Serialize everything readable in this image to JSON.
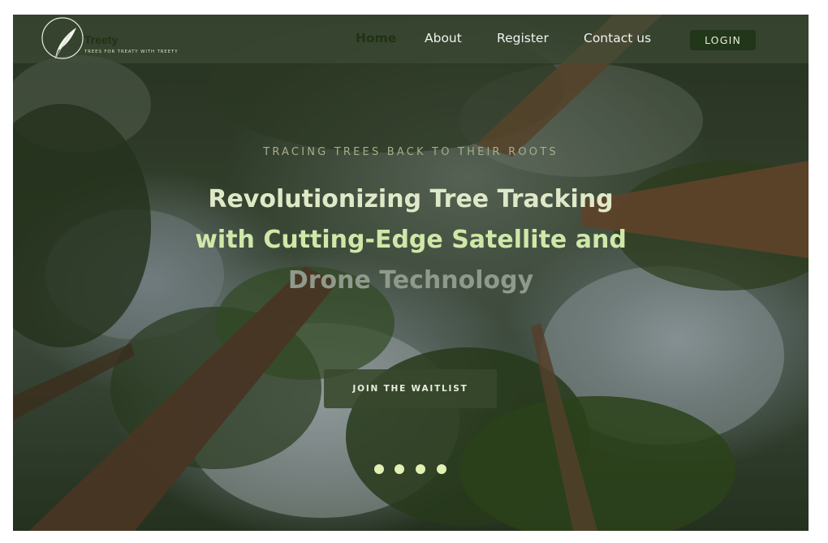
{
  "brand": {
    "name": "Treety",
    "tagline": "TREES FOR TREATY WITH TREETY",
    "logo_icon": "feather-icon"
  },
  "nav": {
    "items": [
      {
        "label": "Home",
        "active": true
      },
      {
        "label": "About",
        "active": false
      },
      {
        "label": "Register",
        "active": false
      },
      {
        "label": "Contact us",
        "active": false
      }
    ],
    "login_label": "LOGIN"
  },
  "hero": {
    "kicker": "TRACING TREES BACK TO THEIR ROOTS",
    "headline_lines": [
      "Revolutionizing Tree Tracking",
      "with Cutting-Edge Satellite and",
      "Drone Technology"
    ],
    "cta_label": "JOIN THE WAITLIST",
    "background_image": "forest canopy viewed from below"
  },
  "carousel": {
    "slide_count": 4
  },
  "colors": {
    "accent_dark_green": "#22361a",
    "headline_light": "#dfe9c8",
    "dot": "#e3f0b4"
  }
}
